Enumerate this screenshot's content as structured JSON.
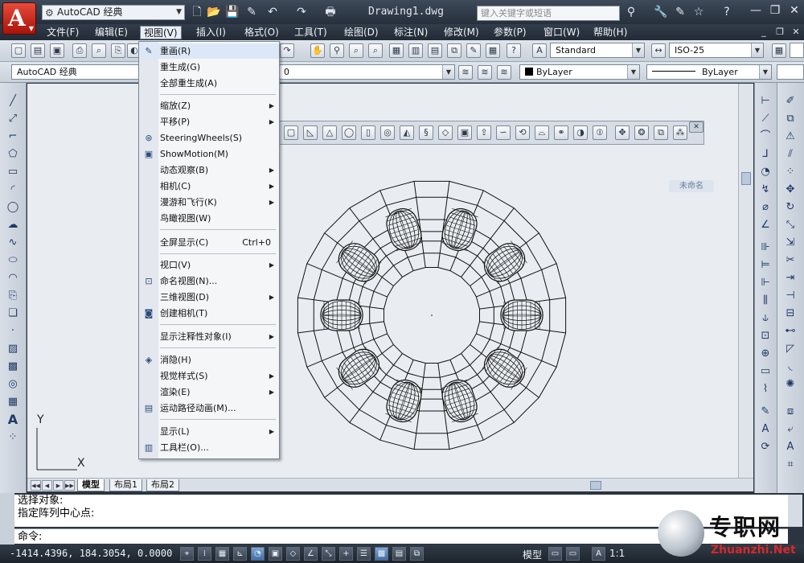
{
  "titlebar": {
    "workspace": "AutoCAD 经典",
    "document_title": "Drawing1.dwg",
    "search_placeholder": "键入关键字或短语"
  },
  "menubar": {
    "items": [
      "文件(F)",
      "编辑(E)",
      "视图(V)",
      "插入(I)",
      "格式(O)",
      "工具(T)",
      "绘图(D)",
      "标注(N)",
      "修改(M)",
      "参数(P)",
      "窗口(W)",
      "帮助(H)"
    ],
    "active": "视图(V)"
  },
  "toolbar": {
    "text_style": "Standard",
    "dim_style": "ISO-25",
    "workspace_combo": "AutoCAD 经典",
    "layer_combo": "0",
    "color_combo": "ByLayer",
    "linetype_combo": "ByLayer"
  },
  "view_menu": {
    "items": [
      {
        "label": "重画(R)",
        "icon": "pencil-icon",
        "sub": false,
        "shortcut": ""
      },
      {
        "label": "重生成(G)",
        "icon": "",
        "sub": false,
        "shortcut": ""
      },
      {
        "label": "全部重生成(A)",
        "icon": "",
        "sub": false,
        "shortcut": ""
      },
      {
        "label": "缩放(Z)",
        "icon": "",
        "sub": true,
        "shortcut": ""
      },
      {
        "label": "平移(P)",
        "icon": "",
        "sub": true,
        "shortcut": ""
      },
      {
        "label": "SteeringWheels(S)",
        "icon": "steering-wheel-icon",
        "sub": false,
        "shortcut": ""
      },
      {
        "label": "ShowMotion(M)",
        "icon": "showmotion-icon",
        "sub": false,
        "shortcut": ""
      },
      {
        "label": "动态观察(B)",
        "icon": "",
        "sub": true,
        "shortcut": ""
      },
      {
        "label": "相机(C)",
        "icon": "",
        "sub": true,
        "shortcut": ""
      },
      {
        "label": "漫游和飞行(K)",
        "icon": "",
        "sub": true,
        "shortcut": ""
      },
      {
        "label": "鸟瞰视图(W)",
        "icon": "",
        "sub": false,
        "shortcut": ""
      },
      {
        "label": "全屏显示(C)",
        "icon": "",
        "sub": false,
        "shortcut": "Ctrl+0"
      },
      {
        "label": "视口(V)",
        "icon": "",
        "sub": true,
        "shortcut": ""
      },
      {
        "label": "命名视图(N)...",
        "icon": "named-view-icon",
        "sub": false,
        "shortcut": ""
      },
      {
        "label": "三维视图(D)",
        "icon": "",
        "sub": true,
        "shortcut": ""
      },
      {
        "label": "创建相机(T)",
        "icon": "camera-icon",
        "sub": false,
        "shortcut": ""
      },
      {
        "label": "显示注释性对象(I)",
        "icon": "",
        "sub": true,
        "shortcut": ""
      },
      {
        "label": "消隐(H)",
        "icon": "hide-icon",
        "sub": false,
        "shortcut": ""
      },
      {
        "label": "视觉样式(S)",
        "icon": "",
        "sub": true,
        "shortcut": ""
      },
      {
        "label": "渲染(E)",
        "icon": "",
        "sub": true,
        "shortcut": ""
      },
      {
        "label": "运动路径动画(M)...",
        "icon": "motion-path-icon",
        "sub": false,
        "shortcut": ""
      },
      {
        "label": "显示(L)",
        "icon": "",
        "sub": true,
        "shortcut": ""
      },
      {
        "label": "工具栏(O)...",
        "icon": "toolbar-icon",
        "sub": false,
        "shortcut": ""
      }
    ]
  },
  "viewcube": {
    "label": "未命名"
  },
  "ucs": {
    "y_label": "Y",
    "x_label": "X"
  },
  "layout_tabs": [
    "模型",
    "布局1",
    "布局2"
  ],
  "command": {
    "history": [
      "选择对象:",
      "指定阵列中心点:"
    ],
    "prompt": "命令:"
  },
  "status": {
    "coordinates": "-1414.4396, 184.3054, 0.0000",
    "model_label": "模型",
    "scale_label": "1:1"
  },
  "watermark": {
    "cn": "专职网",
    "en": "Zhuanzhi.Net"
  }
}
